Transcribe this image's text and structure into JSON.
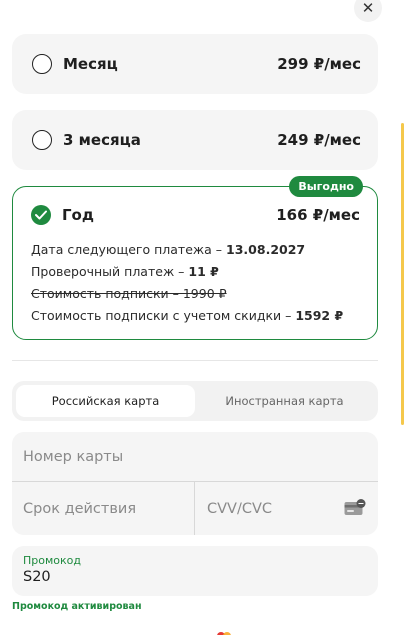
{
  "plans": [
    {
      "name": "Месяц",
      "price": "299 ₽/мес"
    },
    {
      "name": "3 месяца",
      "price": "249 ₽/мес"
    }
  ],
  "selected_plan": {
    "name": "Год",
    "price": "166 ₽/мес",
    "badge": "Выгодно",
    "next_payment_label": "Дата следующего платежа – ",
    "next_payment_value": "13.08.2027",
    "test_payment_label": "Проверочный платеж – ",
    "test_payment_value": "11 ₽",
    "full_price_text": "Стоимость подписки – 1990 ₽",
    "discount_label": "Стоимость подписки с учетом скидки – ",
    "discount_value": "1592 ₽"
  },
  "tabs": [
    {
      "label": "Российская карта",
      "active": true
    },
    {
      "label": "Иностранная карта",
      "active": false
    }
  ],
  "card": {
    "number_placeholder": "Номер карты",
    "expiry_placeholder": "Срок действия",
    "cvv_placeholder": "CVV/CVC"
  },
  "promo": {
    "label": "Промокод",
    "value": "S20",
    "status": "Промокод активирован"
  },
  "icons": {
    "close": "close-icon",
    "check": "check-icon",
    "cvv": "card-cvv-icon"
  },
  "colors": {
    "accent": "#1f8a3f",
    "scroll": "#f5c84b"
  }
}
